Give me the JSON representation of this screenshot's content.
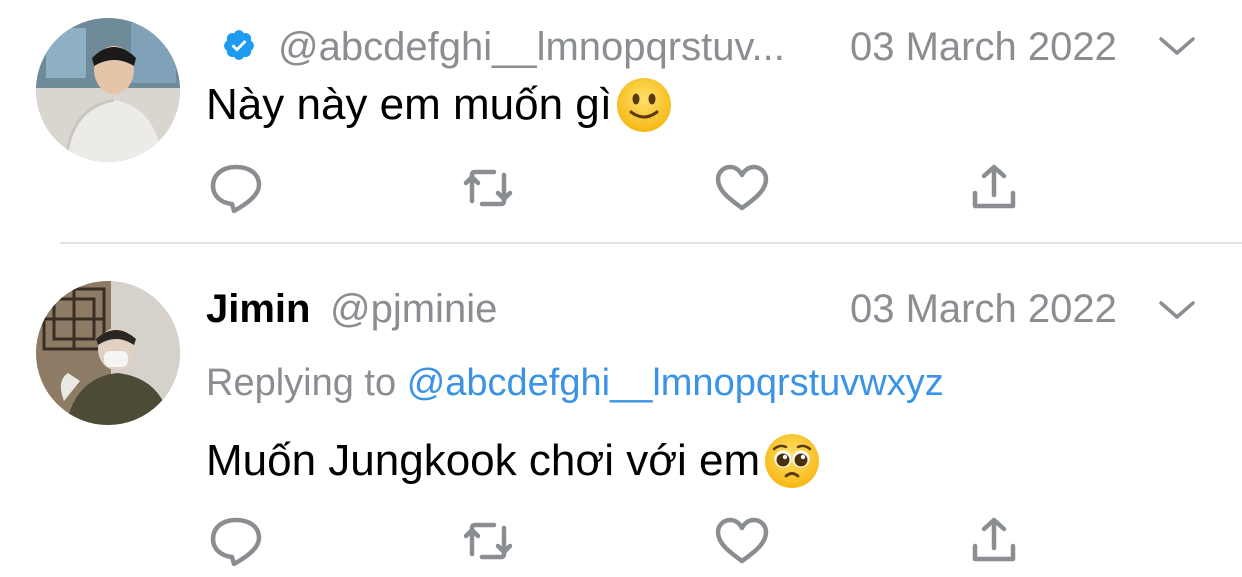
{
  "tweets": [
    {
      "verified": true,
      "handle": "@abcdefghi__lmnopqrstuv...",
      "date": "03 March 2022",
      "text": "Này này em muốn gì",
      "emoji": "slightly-smiling-face"
    },
    {
      "name": "Jimin",
      "handle": "@pjminie",
      "date": "03 March 2022",
      "replying_label": "Replying to",
      "replying_to": "@abcdefghi__lmnopqrstuvwxyz",
      "text": "Muốn Jungkook chơi với em",
      "emoji": "pleading-face"
    }
  ],
  "icons": {
    "reply": "reply-icon",
    "retweet": "retweet-icon",
    "like": "heart-icon",
    "share": "share-icon"
  },
  "colors": {
    "verified": "#1d9bf0",
    "secondary_text": "#8a8d91",
    "mention": "#3b93e6",
    "action_icon": "#8a8d91",
    "divider": "#e1e3e6"
  }
}
